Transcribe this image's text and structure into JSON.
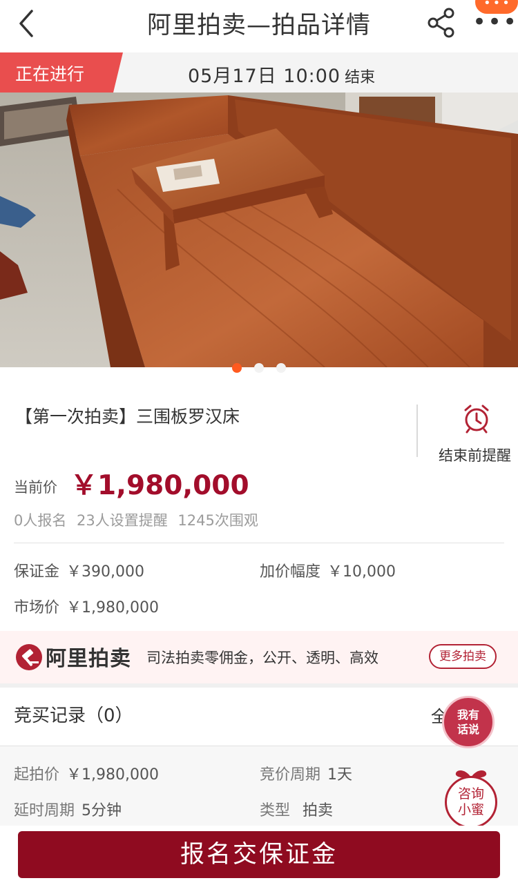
{
  "nav": {
    "title": "阿里拍卖—拍品详情"
  },
  "status": {
    "label": "正在进行",
    "end_time": "05月17日 10:00",
    "end_suffix": "结束"
  },
  "carousel": {
    "active_index": 0,
    "count": 3
  },
  "product": {
    "title": "【第一次拍卖】三围板罗汉床",
    "remind_label": "结束前提醒",
    "price_label": "当前价",
    "price_value": "￥1,980,000",
    "stats": "0人报名 23人设置提醒 1245次围观"
  },
  "terms": {
    "deposit": {
      "label": "保证金",
      "value": "￥390,000"
    },
    "increment": {
      "label": "加价幅度",
      "value": "￥10,000"
    },
    "market_price": {
      "label": "市场价",
      "value": "￥1,980,000"
    }
  },
  "banner": {
    "brand": "阿里拍卖",
    "slogan": "司法拍卖零佣金，公开、透明、高效",
    "more_button": "更多拍卖"
  },
  "bid_records": {
    "label": "竞买记录（0）",
    "all_prefix": "全"
  },
  "details": {
    "start_price": {
      "label": "起拍价",
      "value": "￥1,980,000"
    },
    "bid_period": {
      "label": "竞价周期",
      "value": "1天"
    },
    "extend_period": {
      "label": "延时周期",
      "value": "5分钟"
    },
    "type": {
      "label": "类型",
      "value": "拍卖"
    }
  },
  "floating": {
    "talk_line1": "我有",
    "talk_line2": "话说",
    "assist_line1": "咨询",
    "assist_line2": "小蜜"
  },
  "cta": {
    "label": "报名交保证金"
  },
  "colors": {
    "accent": "#a20d2b",
    "cta": "#8f0b20",
    "status_tag": "#e94e4e",
    "dot_active": "#ff5a1f"
  }
}
